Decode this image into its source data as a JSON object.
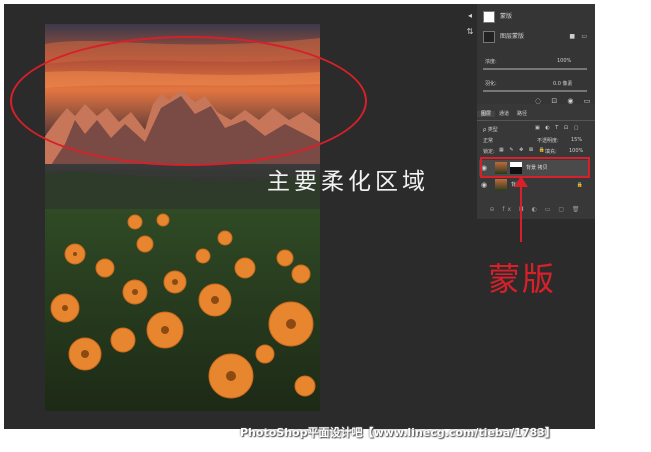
{
  "annotation": {
    "main_label": "主要柔化区域",
    "mask_label": "蒙版"
  },
  "watermark": "PhotoShop平面设计吧【www.linecg.com/tieba/1783】",
  "properties": {
    "header": "蒙版",
    "row1_label": "图层蒙版",
    "density_label": "浓度:",
    "density_value": "100%",
    "feather_label": "羽化:",
    "feather_value": "0.0 像素"
  },
  "layers_panel": {
    "tabs": [
      "图层",
      "通道",
      "路径"
    ],
    "filter_label": "ρ 类型",
    "blend_mode": "正常",
    "opacity_label": "不透明度:",
    "opacity_value": "15%",
    "lock_label": "锁定:",
    "fill_label": "填充:",
    "fill_value": "100%",
    "layers": [
      {
        "name": "背景 拷贝"
      },
      {
        "name": "背景"
      }
    ]
  },
  "colors": {
    "annotation_red": "#d8202a",
    "workspace": "#2b2b2b",
    "panel": "#383838"
  }
}
